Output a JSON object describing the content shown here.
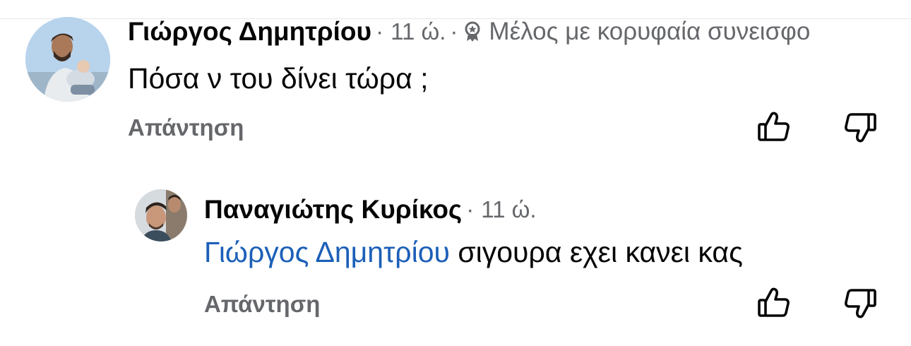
{
  "comment": {
    "author": "Γιώργος Δημητρίου",
    "time": "11 ώ.",
    "badge_icon": "top-fan-badge-icon",
    "badge_label": "Μέλος με κορυφαία συνεισφο",
    "text": "Πόσα ν του δίνει τώρα ;",
    "reply_label": "Απάντηση",
    "like_icon": "thumbs-up-icon",
    "dislike_icon": "thumbs-down-icon"
  },
  "reply": {
    "author": "Παναγιώτης Κυρίκος",
    "time": "11 ώ.",
    "mention": "Γιώργος Δημητρίου",
    "text": " σιγουρα εχει κανει κας",
    "reply_label": "Απάντηση",
    "like_icon": "thumbs-up-icon",
    "dislike_icon": "thumbs-down-icon"
  },
  "colors": {
    "mention": "#1c5fb8",
    "secondary_text": "#65676b",
    "primary_text": "#050505"
  }
}
